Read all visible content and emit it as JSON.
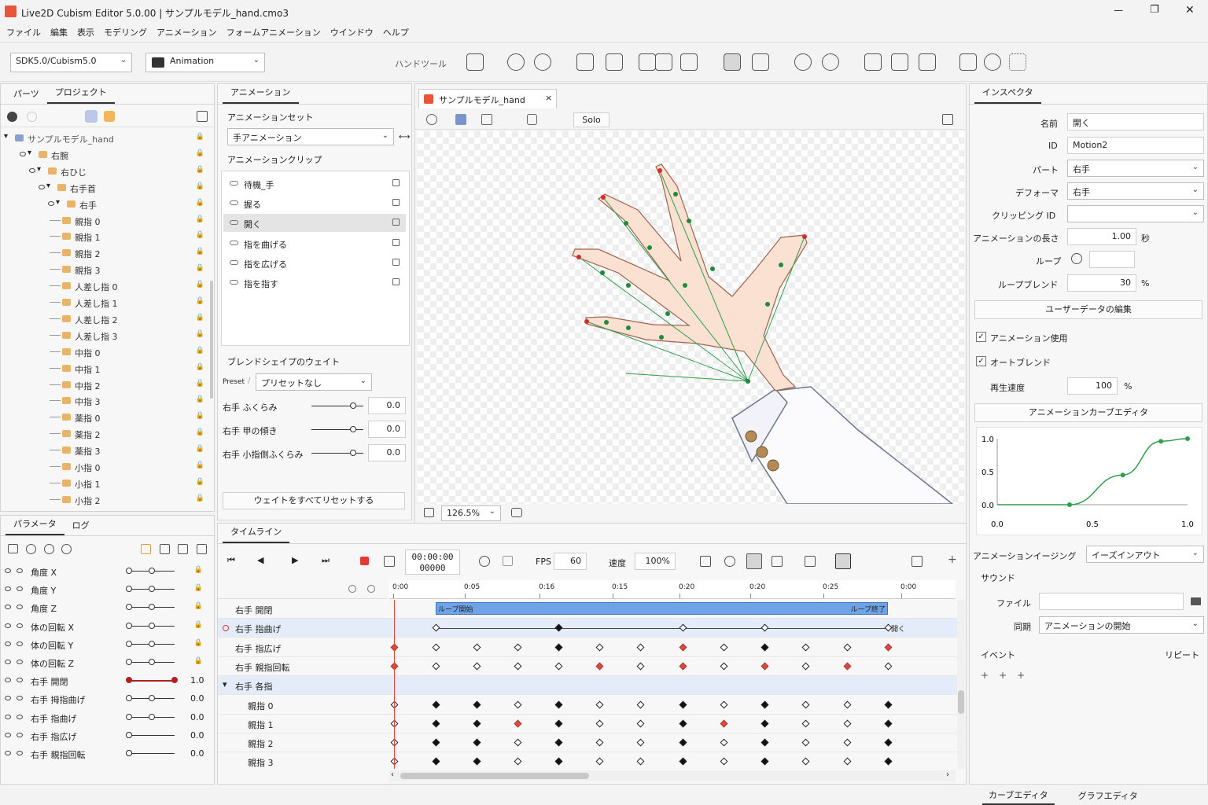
{
  "window": {
    "title": "Live2D Cubism Editor 5.0.00 | サンプルモデル_hand.cmo3",
    "min": "—",
    "max": "❐",
    "close": "✕"
  },
  "menu": [
    "ファイル",
    "編集",
    "表示",
    "モデリング",
    "アニメーション",
    "フォームアニメーション",
    "ウインドウ",
    "ヘルプ"
  ],
  "toolbar": {
    "sdk": "SDK5.0/Cubism5.0",
    "mode": "Animation",
    "hand_tool": "ハンドツール"
  },
  "parts_panel": {
    "tabs": [
      "パーツ",
      "プロジェクト"
    ],
    "tree": [
      {
        "label": "サンプルモデル_hand",
        "indent": 0
      },
      {
        "label": "右腕",
        "indent": 1
      },
      {
        "label": "右ひじ",
        "indent": 2
      },
      {
        "label": "右手首",
        "indent": 3
      },
      {
        "label": "右手",
        "indent": 4
      },
      {
        "label": "親指 0",
        "indent": 5
      },
      {
        "label": "親指 1",
        "indent": 5
      },
      {
        "label": "親指 2",
        "indent": 5
      },
      {
        "label": "親指 3",
        "indent": 5
      },
      {
        "label": "人差し指 0",
        "indent": 5
      },
      {
        "label": "人差し指 1",
        "indent": 5
      },
      {
        "label": "人差し指 2",
        "indent": 5
      },
      {
        "label": "人差し指 3",
        "indent": 5
      },
      {
        "label": "中指 0",
        "indent": 5
      },
      {
        "label": "中指 1",
        "indent": 5
      },
      {
        "label": "中指 2",
        "indent": 5
      },
      {
        "label": "中指 3",
        "indent": 5
      },
      {
        "label": "薬指 0",
        "indent": 5
      },
      {
        "label": "薬指 2",
        "indent": 5
      },
      {
        "label": "薬指 3",
        "indent": 5
      },
      {
        "label": "小指 0",
        "indent": 5
      },
      {
        "label": "小指 1",
        "indent": 5
      },
      {
        "label": "小指 2",
        "indent": 5
      }
    ]
  },
  "params_panel": {
    "tabs": [
      "パラメータ",
      "ログ"
    ],
    "params": [
      {
        "label": "角度 X",
        "value": "",
        "level": 0.5,
        "locked": true
      },
      {
        "label": "角度 Y",
        "value": "",
        "level": 0.5,
        "locked": true
      },
      {
        "label": "角度 Z",
        "value": "",
        "level": 0.5,
        "locked": true
      },
      {
        "label": "体の回転 X",
        "value": "",
        "level": 0.5,
        "locked": true
      },
      {
        "label": "体の回転 Y",
        "value": "",
        "level": 0.5,
        "locked": true
      },
      {
        "label": "体の回転 Z",
        "value": "",
        "level": 0.5,
        "locked": true
      },
      {
        "label": "右手 開閉",
        "value": "1.0",
        "level": 1.0,
        "locked": false
      },
      {
        "label": "右手 拇指曲げ",
        "value": "0.0",
        "level": 0.5,
        "locked": false
      },
      {
        "label": "右手 指曲げ",
        "value": "0.0",
        "level": 0.5,
        "locked": false
      },
      {
        "label": "右手 指広げ",
        "value": "0.0",
        "level": 0.0,
        "locked": false
      },
      {
        "label": "右手 親指回転",
        "value": "0.0",
        "level": 0.0,
        "locked": false
      }
    ]
  },
  "anim_panel": {
    "title": "アニメーション",
    "set_label": "アニメーションセット",
    "set_value": "手アニメーション",
    "clip_label": "アニメーションクリップ",
    "clips": [
      {
        "label": "待機_手"
      },
      {
        "label": "握る"
      },
      {
        "label": "開く"
      },
      {
        "label": "指を曲げる"
      },
      {
        "label": "指を広げる"
      },
      {
        "label": "指を指す"
      }
    ],
    "blend_label": "ブレンドシェイプのウェイト",
    "preset_label": "Preset",
    "preset_value": "プリセットなし",
    "weights": [
      {
        "label": "右手 ふくらみ",
        "value": "0.0",
        "level": 0.8
      },
      {
        "label": "右手 甲の傾き",
        "value": "0.0",
        "level": 0.8
      },
      {
        "label": "右手 小指側ふくらみ",
        "value": "0.0",
        "level": 0.8
      }
    ],
    "reset_label": "ウェイトをすべてリセットする"
  },
  "viewport": {
    "tab": "サンプルモデル_hand",
    "close": "×",
    "solo": "Solo",
    "zoom": "126.5%"
  },
  "inspector": {
    "title": "インスペクタ",
    "name_label": "名前",
    "name": "開く",
    "id_label": "ID",
    "id": "Motion2",
    "part_label": "パート",
    "part": "右手",
    "deformer_label": "デフォーマ",
    "deformer": "右手",
    "clip_label": "クリッピング ID",
    "clip": "",
    "length_label": "アニメーションの長さ",
    "length": "1.00",
    "length_unit": "秒",
    "loop_label": "ループ",
    "loop_blend_label": "ループブレンド",
    "loop_blend": "30",
    "percent": "%",
    "userdata_button": "ユーザーデータの編集",
    "use_anim": "アニメーション使用",
    "auto_blend": "オートブレンド",
    "speed_label": "再生速度",
    "speed": "100",
    "curve_editor_button": "アニメーションカーブエディタ",
    "easing_label": "アニメーションイージング",
    "easing": "イーズインアウト",
    "sound_label": "サウンド",
    "file_label": "ファイル",
    "sync_label": "同期",
    "sync": "アニメーションの開始",
    "event_label": "イベント",
    "repeat_label": "リピート",
    "bottom_tabs": [
      "カーブエディタ",
      "グラフエディタ"
    ]
  },
  "curve": {
    "yticks": [
      "1.0",
      "0.5",
      "0.0"
    ],
    "xticks": [
      "0.0",
      "0.5",
      "1.0"
    ],
    "points": [
      [
        0,
        0
      ],
      [
        0.38,
        0
      ],
      [
        0.66,
        0.45
      ],
      [
        0.86,
        0.96
      ],
      [
        1,
        1
      ]
    ]
  },
  "timeline": {
    "title": "タイムライン",
    "time": "00:00:00",
    "frame": "00000",
    "fps_label": "FPS",
    "fps": "60",
    "speed_label": "速度",
    "speed": "100%",
    "ruler": [
      "0:00",
      "0:05",
      "0:16",
      "0:15",
      "0:20",
      "0:20",
      "0:25",
      "0:00"
    ],
    "loop_start": "ループ開始",
    "loop_end": "ループ終了",
    "open_label": "開く",
    "tracks": [
      {
        "label": "右手 開閉",
        "kf": []
      },
      {
        "label": "右手 指曲げ",
        "kf": [
          "w",
          "b",
          "w",
          "w",
          "w"
        ]
      },
      {
        "label": "右手 指広げ",
        "kf": [
          "r",
          "w",
          "w",
          "w",
          "b",
          "w",
          "w",
          "r",
          "w",
          "b",
          "w",
          "w",
          "r"
        ]
      },
      {
        "label": "右手 親指回転",
        "kf": [
          "r",
          "w",
          "w",
          "w",
          "w",
          "r",
          "w",
          "r",
          "w",
          "r",
          "w",
          "r",
          "w"
        ]
      },
      {
        "label": "右手 各指",
        "kf": []
      },
      {
        "label": "親指 0",
        "kf": [
          "w",
          "b",
          "b",
          "w",
          "b",
          "w",
          "w",
          "b",
          "w",
          "b",
          "w",
          "w",
          "b"
        ]
      },
      {
        "label": "親指 1",
        "kf": [
          "w",
          "b",
          "b",
          "r",
          "b",
          "w",
          "w",
          "b",
          "r",
          "b",
          "w",
          "w",
          "b"
        ]
      },
      {
        "label": "親指 2",
        "kf": [
          "w",
          "b",
          "b",
          "w",
          "b",
          "w",
          "w",
          "b",
          "w",
          "b",
          "w",
          "w",
          "b"
        ]
      },
      {
        "label": "親指 3",
        "kf": [
          "w",
          "b",
          "b",
          "w",
          "b",
          "w",
          "w",
          "b",
          "w",
          "b",
          "w",
          "w",
          "b"
        ]
      }
    ]
  }
}
